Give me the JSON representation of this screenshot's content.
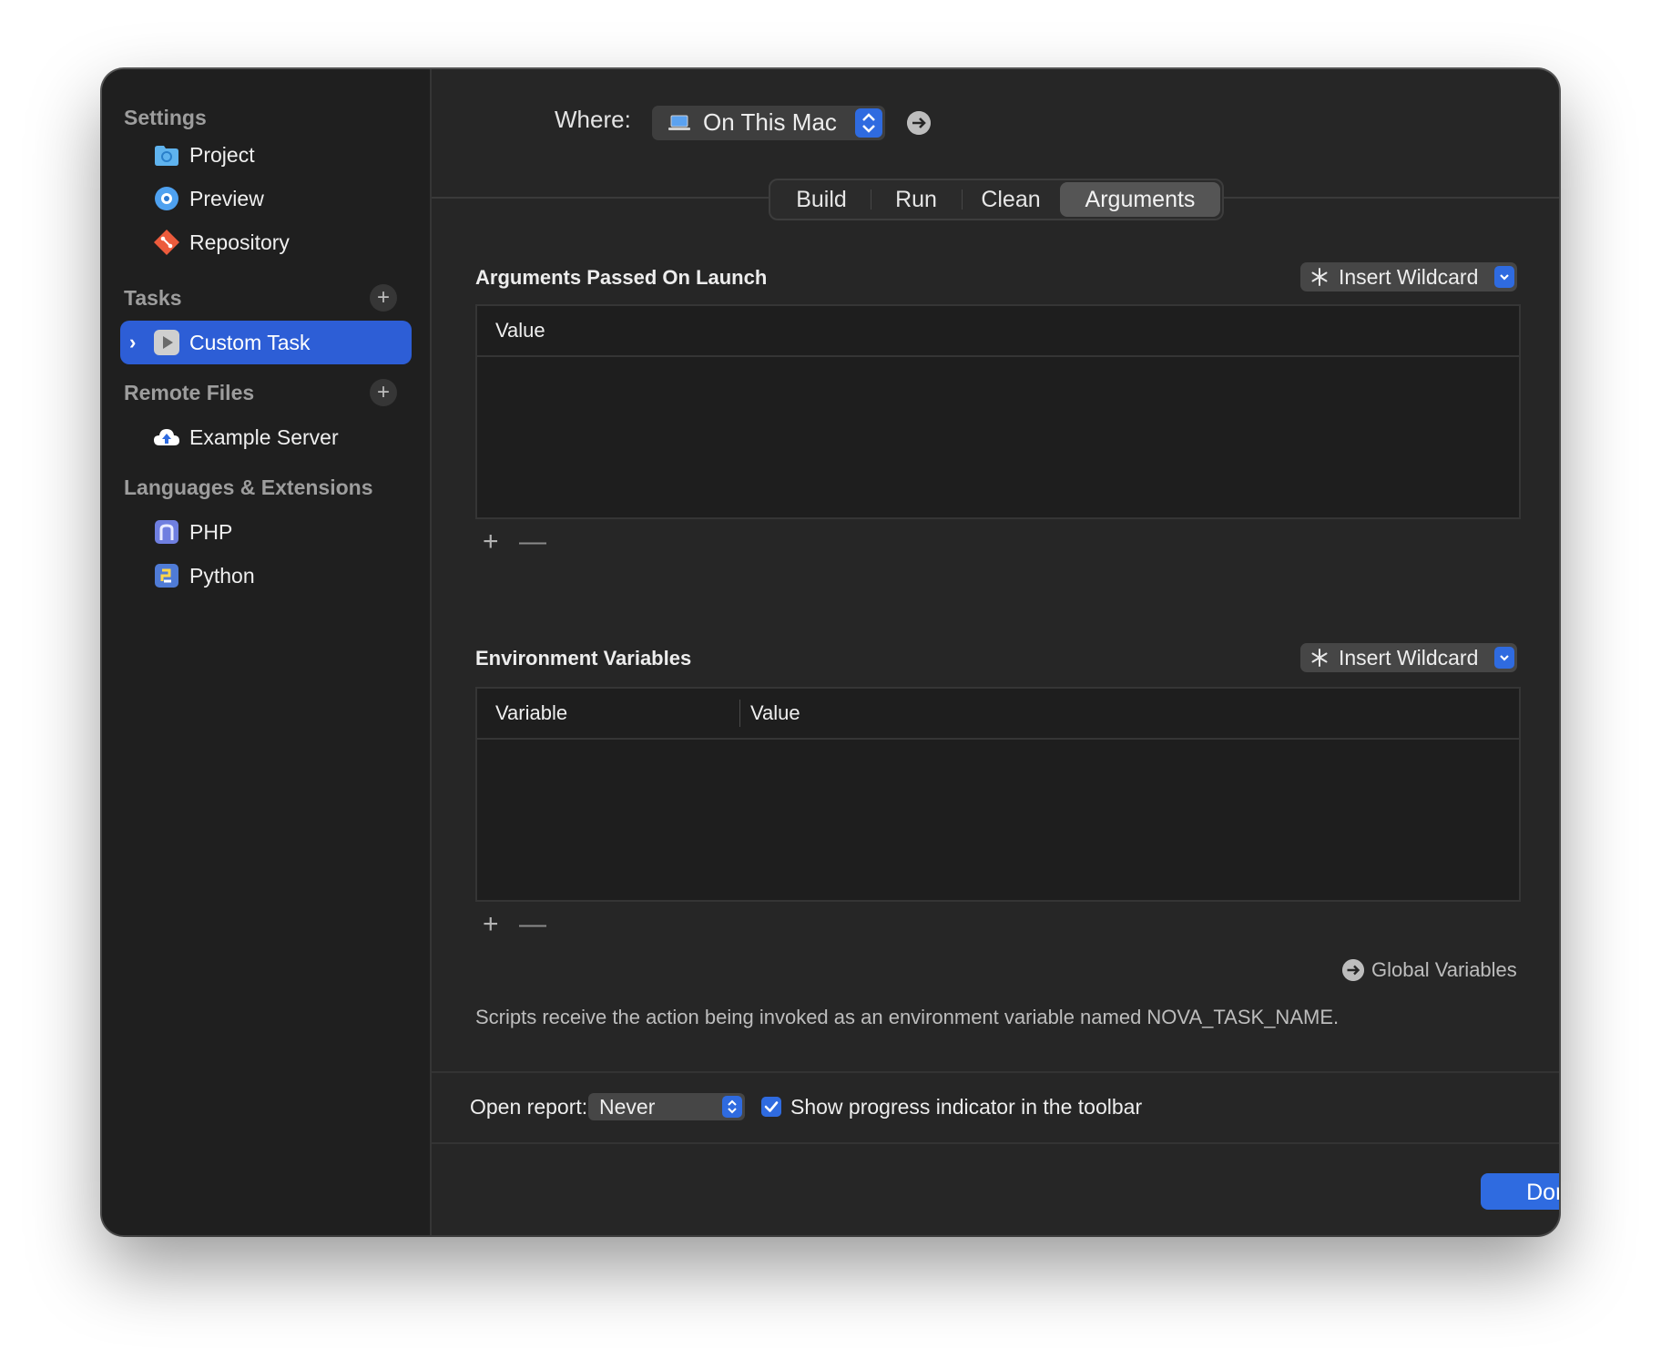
{
  "sidebar": {
    "settings_header": "Settings",
    "settings_items": [
      {
        "label": "Project",
        "icon": "project-folder-icon"
      },
      {
        "label": "Preview",
        "icon": "preview-eye-icon"
      },
      {
        "label": "Repository",
        "icon": "git-repository-icon"
      }
    ],
    "tasks_header": "Tasks",
    "tasks_items": [
      {
        "label": "Custom Task",
        "icon": "play-task-icon",
        "selected": true,
        "expandable": true
      }
    ],
    "remote_header": "Remote Files",
    "remote_items": [
      {
        "label": "Example Server",
        "icon": "cloud-server-icon"
      }
    ],
    "languages_header": "Languages & Extensions",
    "language_items": [
      {
        "label": "PHP",
        "icon": "php-extension-icon"
      },
      {
        "label": "Python",
        "icon": "python-extension-icon"
      }
    ]
  },
  "where": {
    "label": "Where:",
    "value": "On This Mac",
    "icon": "laptop-icon"
  },
  "tabs": [
    {
      "label": "Build",
      "active": false
    },
    {
      "label": "Run",
      "active": false
    },
    {
      "label": "Clean",
      "active": false
    },
    {
      "label": "Arguments",
      "active": true
    }
  ],
  "arguments_section": {
    "title": "Arguments Passed On Launch",
    "wildcard_label": "Insert Wildcard",
    "columns": [
      "Value"
    ],
    "rows": []
  },
  "env_section": {
    "title": "Environment Variables",
    "wildcard_label": "Insert Wildcard",
    "columns": [
      "Variable",
      "Value"
    ],
    "rows": []
  },
  "add_symbol": "+",
  "remove_symbol": "—",
  "global_variables_label": "Global Variables",
  "note": "Scripts receive the action being invoked as an environment variable named NOVA_TASK_NAME.",
  "report": {
    "label": "Open report:",
    "value": "Never"
  },
  "progress_checkbox": {
    "label": "Show progress indicator in the toolbar",
    "checked": true
  },
  "done_label": "Done",
  "colors": {
    "accent": "#2f6be0",
    "selection": "#2d5ed6",
    "window_bg": "#262626",
    "sidebar_bg": "#1f1f1f"
  }
}
